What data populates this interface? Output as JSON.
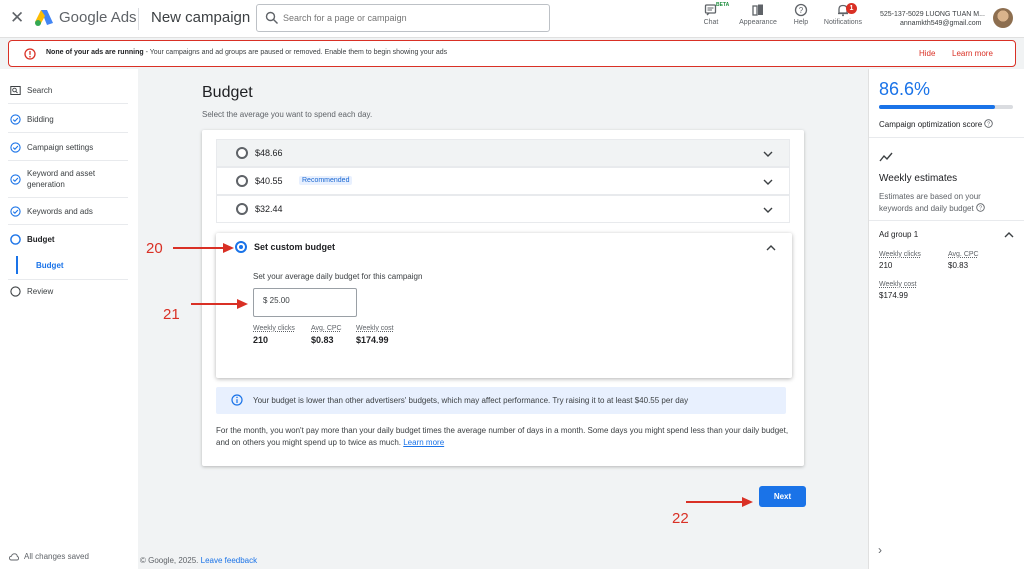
{
  "header": {
    "brand": "Google Ads",
    "title": "New campaign",
    "search_placeholder": "Search for a page or campaign",
    "tools": [
      {
        "label": "Chat",
        "badge": "BETA"
      },
      {
        "label": "Appearance"
      },
      {
        "label": "Help"
      },
      {
        "label": "Notifications",
        "count": "1"
      }
    ],
    "account_line1": "525-137-5029 LUONG TUAN M...",
    "account_line2": "annamkth549@gmail.com"
  },
  "alert": {
    "bold": "None of your ads are running",
    "text": " - Your campaigns and ad groups are paused or removed. Enable them to begin showing your ads",
    "hide": "Hide",
    "learn_more": "Learn more"
  },
  "nav": {
    "items": [
      {
        "label": "Search",
        "icon": "search-doc-icon"
      },
      {
        "label": "Bidding",
        "icon": "check-circle-icon"
      },
      {
        "label": "Campaign settings",
        "icon": "check-circle-icon"
      },
      {
        "label": "Keyword and asset generation",
        "icon": "check-circle-icon"
      },
      {
        "label": "Keywords and ads",
        "icon": "check-circle-icon"
      },
      {
        "label": "Budget",
        "icon": "circle-icon"
      },
      {
        "label": "Review",
        "icon": "circle-icon"
      }
    ],
    "sub_item": "Budget",
    "saved": "All changes saved"
  },
  "budget": {
    "heading": "Budget",
    "subheading": "Select the average you want to spend each day.",
    "options": [
      {
        "label": "$48.66",
        "badge": ""
      },
      {
        "label": "$40.55",
        "badge": "Recommended"
      },
      {
        "label": "$32.44",
        "badge": ""
      }
    ],
    "custom": {
      "label": "Set custom budget",
      "description": "Set your average daily budget for this campaign",
      "value": "$ 25.00",
      "stats": [
        {
          "label": "Weekly clicks",
          "value": "210"
        },
        {
          "label": "Avg. CPC",
          "value": "$0.83"
        },
        {
          "label": "Weekly cost",
          "value": "$174.99"
        }
      ]
    },
    "info": "Your budget is lower than other advertisers' budgets, which may affect performance. Try raising it to at least $40.55 per day",
    "month_note": "For the month, you won't pay more than your daily budget times the average number of days in a month. Some days you might spend less than your daily budget, and on others you might spend up to twice as much.",
    "learn_more": "Learn more",
    "next": "Next"
  },
  "footer": {
    "copyright": "© Google, 2025.",
    "feedback": "Leave feedback"
  },
  "annotations": [
    "20",
    "21",
    "22"
  ],
  "right_panel": {
    "score": "86.6%",
    "score_fraction": 0.866,
    "score_label": "Campaign optimization score",
    "weekly_title": "Weekly estimates",
    "weekly_desc": "Estimates are based on your keywords and daily budget",
    "ad_group": "Ad group 1",
    "stats": [
      {
        "label": "Weekly clicks",
        "value": "210"
      },
      {
        "label": "Avg. CPC",
        "value": "$0.83"
      },
      {
        "label": "Weekly cost",
        "value": "$174.99"
      }
    ]
  },
  "colors": {
    "accent": "#1a73e8",
    "error": "#d93025"
  }
}
